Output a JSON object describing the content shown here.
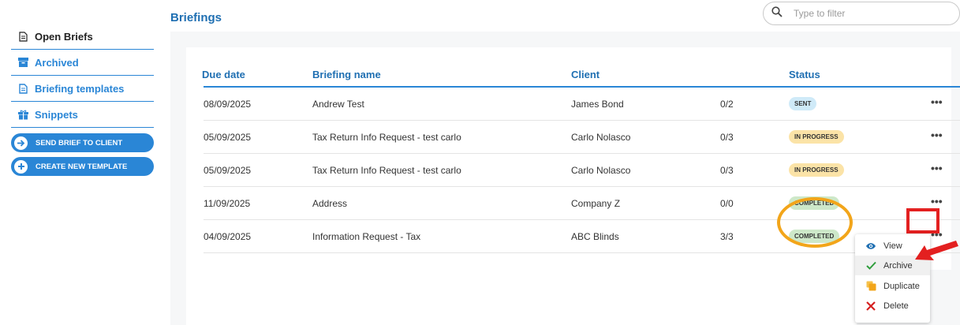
{
  "page": {
    "title": "Briefings",
    "search_placeholder": "Type to filter"
  },
  "sidebar": {
    "items": [
      {
        "label": "Open Briefs",
        "icon": "document-icon"
      },
      {
        "label": "Archived",
        "icon": "archive-box-icon"
      },
      {
        "label": "Briefing templates",
        "icon": "template-document-icon"
      },
      {
        "label": "Snippets",
        "icon": "gift-box-icon"
      }
    ],
    "buttons": [
      {
        "label": "SEND BRIEF TO CLIENT",
        "icon": "arrow-right-icon"
      },
      {
        "label": "CREATE NEW TEMPLATE",
        "icon": "plus-icon"
      }
    ]
  },
  "table": {
    "columns": [
      "Due date",
      "Briefing name",
      "Client",
      "Status"
    ],
    "rows": [
      {
        "due": "08/09/2025",
        "name": "Andrew Test",
        "client": "James Bond",
        "progress": "0/2",
        "status": "SENT",
        "status_kind": "sent"
      },
      {
        "due": "05/09/2025",
        "name": "Tax Return Info Request - test carlo",
        "client": "Carlo Nolasco",
        "progress": "0/3",
        "status": "IN PROGRESS",
        "status_kind": "progress"
      },
      {
        "due": "05/09/2025",
        "name": "Tax Return Info Request - test carlo",
        "client": "Carlo Nolasco",
        "progress": "0/3",
        "status": "IN PROGRESS",
        "status_kind": "progress"
      },
      {
        "due": "11/09/2025",
        "name": "Address",
        "client": "Company Z",
        "progress": "0/0",
        "status": "COMPLETED",
        "status_kind": "completed"
      },
      {
        "due": "04/09/2025",
        "name": "Information Request - Tax",
        "client": "ABC Blinds",
        "progress": "3/3",
        "status": "COMPLETED",
        "status_kind": "completed"
      }
    ],
    "more_icon": "•••"
  },
  "context_menu": {
    "items": [
      {
        "label": "View",
        "icon": "eye-icon"
      },
      {
        "label": "Archive",
        "icon": "checkmark-icon"
      },
      {
        "label": "Duplicate",
        "icon": "copy-icon"
      },
      {
        "label": "Delete",
        "icon": "x-icon"
      }
    ]
  },
  "colors": {
    "accent": "#2a86d6",
    "title": "#1f6fb2",
    "sent": "#cfeaf8",
    "in_progress": "#fbe3a7",
    "completed": "#cde8c9",
    "highlight_orange": "#f2a51a",
    "highlight_red": "#e32020"
  }
}
